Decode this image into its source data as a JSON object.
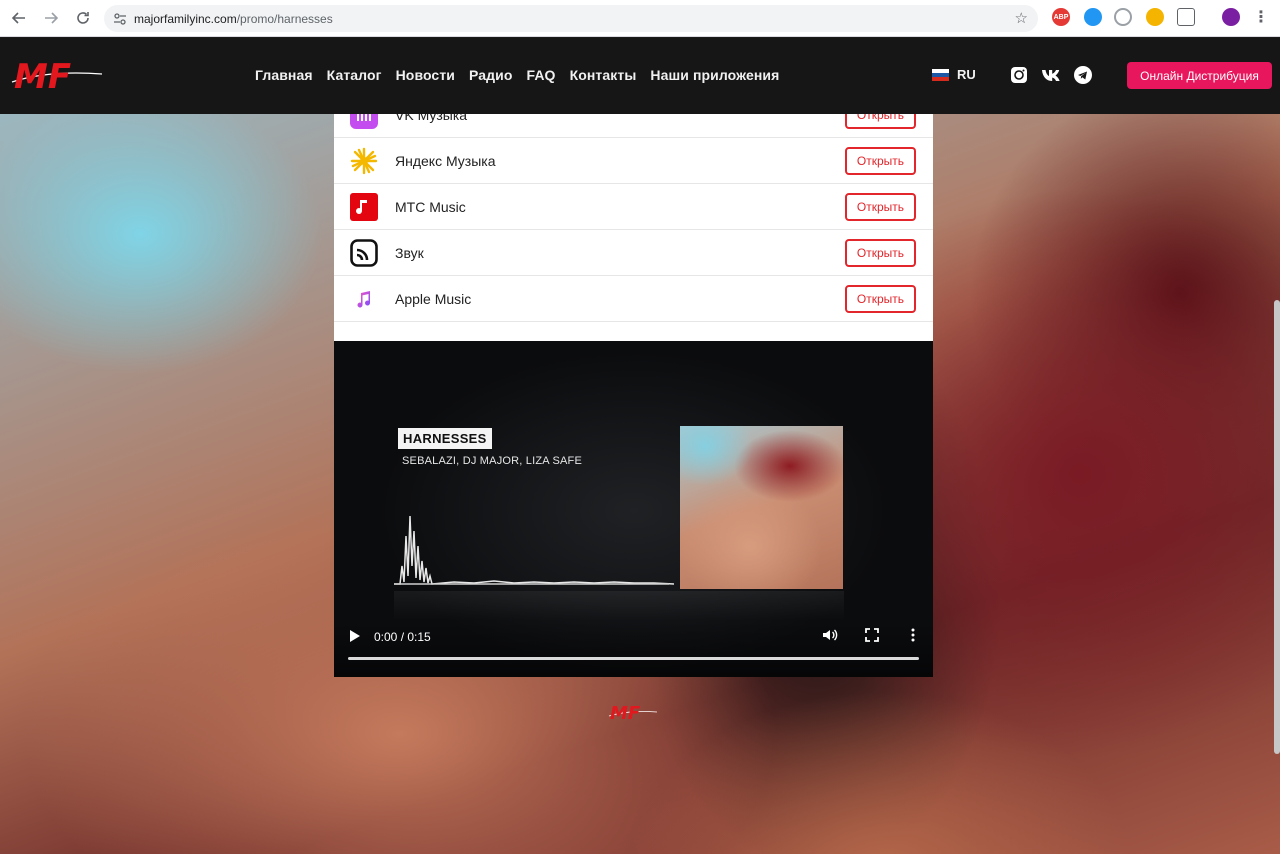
{
  "browser": {
    "url_domain": "majorfamilyinc.com",
    "url_path": "/promo/harnesses",
    "ext_abp": "ABP"
  },
  "header": {
    "logo_text": "MF",
    "nav": [
      "Главная",
      "Каталог",
      "Новости",
      "Радио",
      "FAQ",
      "Контакты",
      "Наши приложения"
    ],
    "language": "RU",
    "cta_label": "Онлайн Дистрибуция",
    "accent_color": "#e8165c"
  },
  "services": {
    "items": [
      {
        "name": "VK Музыка",
        "icon": "vk-music-icon"
      },
      {
        "name": "Яндекс Музыка",
        "icon": "yandex-music-icon"
      },
      {
        "name": "МТС Music",
        "icon": "mts-music-icon"
      },
      {
        "name": "Звук",
        "icon": "zvuk-icon"
      },
      {
        "name": "Apple Music",
        "icon": "apple-music-icon"
      }
    ],
    "open_label": "Открыть",
    "button_color": "#e2262b"
  },
  "video": {
    "title": "HARNESSES",
    "artists": "SEBALAZI, DJ MAJOR, LIZA SAFE",
    "time": "0:00 / 0:15"
  },
  "footer": {
    "logo_text": "MF"
  }
}
